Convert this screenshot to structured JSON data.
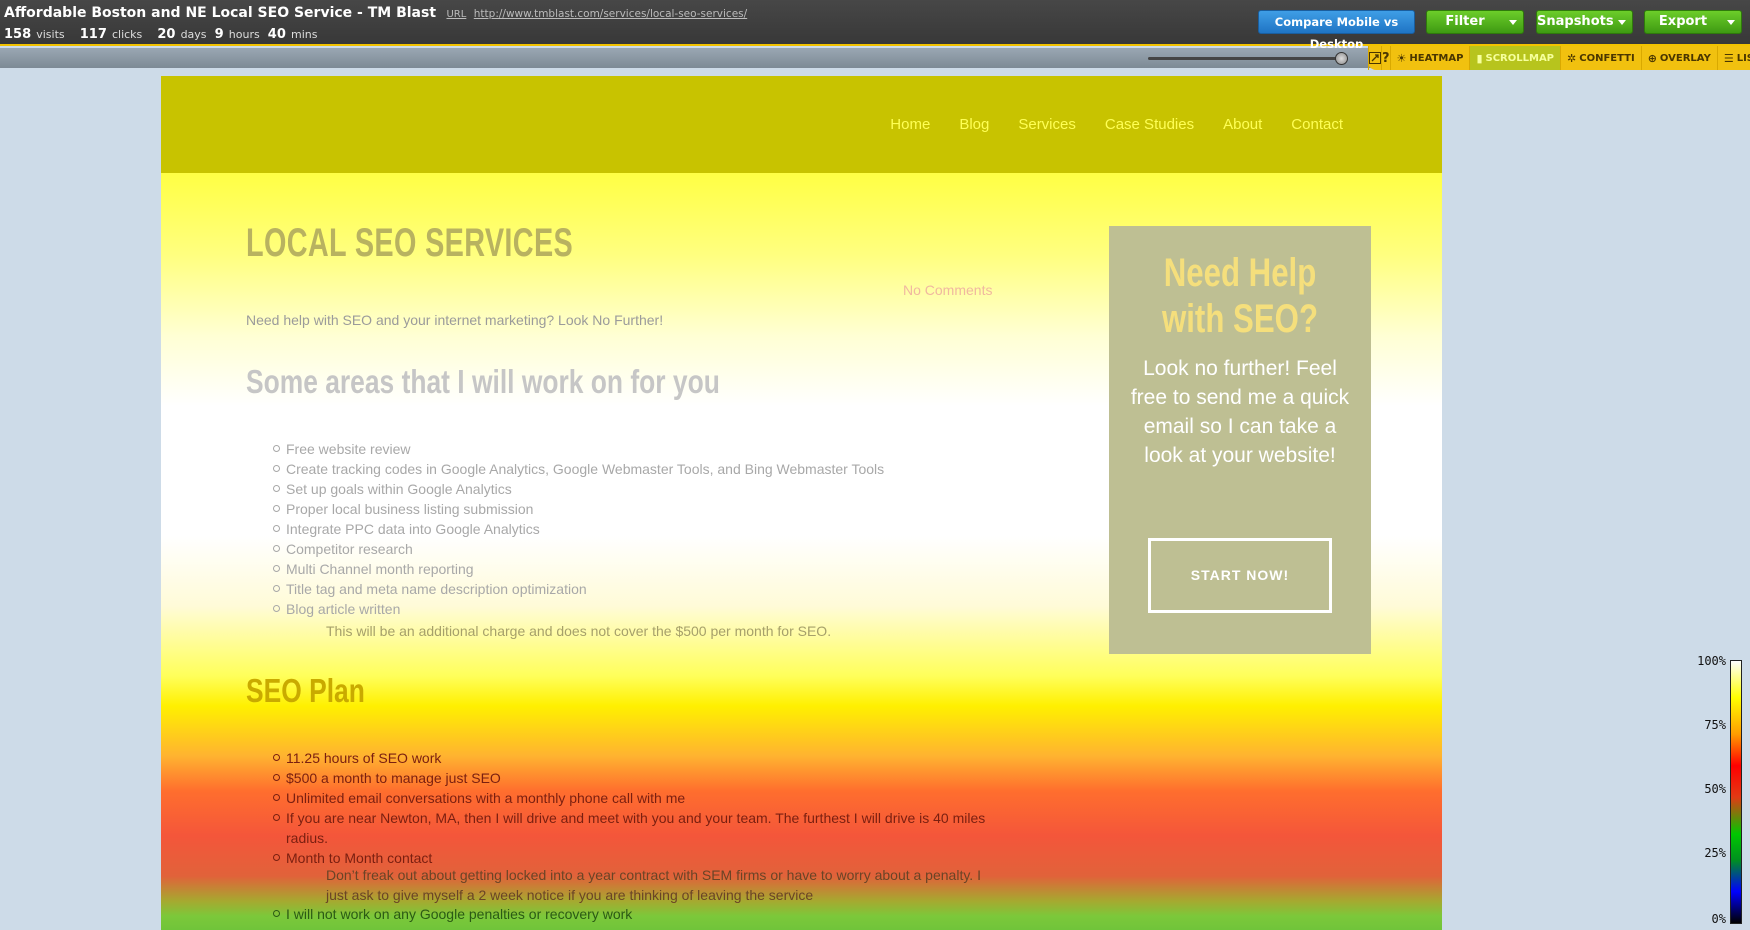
{
  "app": {
    "page_title": "Affordable Boston and NE Local SEO Service - TM Blast",
    "url_label": "URL",
    "url": "http://www.tmblast.com/services/local-seo-services/",
    "stats": {
      "visits_value": "158",
      "visits_label": "visits",
      "clicks_value": "117",
      "clicks_label": "clicks",
      "days_value": "20",
      "days_label": "days",
      "hours_value": "9",
      "hours_label": "hours",
      "mins_value": "40",
      "mins_label": "mins"
    },
    "buttons": {
      "compare": "Compare Mobile vs Desktop",
      "filter": "Filter",
      "snapshots": "Snapshots",
      "export": "Export"
    },
    "mode_tabs": {
      "help": "?",
      "heatmap": "HEATMAP",
      "scrollmap": "SCROLLMAP",
      "confetti": "CONFETTI",
      "overlay": "OVERLAY",
      "list": "LIST"
    },
    "active_mode": "SCROLLMAP",
    "accent_color": "#f1c10f"
  },
  "site": {
    "nav": [
      "Home",
      "Blog",
      "Services",
      "Case Studies",
      "About",
      "Contact"
    ],
    "heading": "LOCAL SEO SERVICES",
    "no_comments": "No Comments",
    "intro": "Need help with SEO and your internet marketing? Look No Further!",
    "areas_heading": "Some areas that I will work on for you",
    "areas": [
      "Free website review",
      "Create tracking codes in Google Analytics, Google Webmaster Tools, and Bing Webmaster Tools",
      "Set up goals within Google Analytics",
      "Proper local business listing submission",
      "Integrate PPC data into Google Analytics",
      "Competitor research",
      "Multi Channel month reporting",
      "Title tag and meta name description optimization",
      "Blog article written"
    ],
    "areas_note": "This will be an additional charge and does not cover the $500 per month for SEO.",
    "plan_heading": "SEO Plan",
    "plan": [
      "11.25 hours of SEO work",
      "$500 a month to manage just SEO",
      "Unlimited email conversations with a monthly phone call with me",
      "If you are near Newton, MA, then I will drive and meet with you and your team. The furthest I will drive is 40 miles radius.",
      "Month to Month contact"
    ],
    "plan_note": "Don’t freak out about getting locked into a year contract with SEM firms or have to worry about a penalty. I just ask to give myself a 2 week notice if you are thinking of leaving the service",
    "plan_more": [
      "I will not work on any Google penalties or recovery work"
    ],
    "cta": {
      "heading": "Need Help with SEO?",
      "body": "Look no further! Feel free to send me a quick email so I can take a look at your website!",
      "button": "START NOW!"
    }
  },
  "legend": {
    "labels": [
      "100%",
      "75%",
      "50%",
      "25%",
      "0%"
    ]
  }
}
